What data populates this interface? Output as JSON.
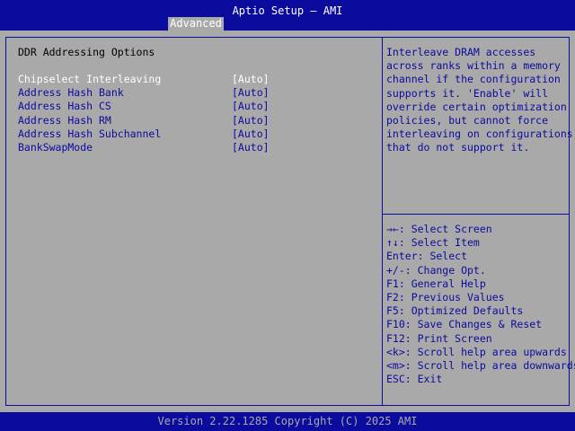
{
  "header": {
    "title": "Aptio Setup – AMI",
    "tabs": [
      {
        "label": "Advanced"
      }
    ]
  },
  "page": {
    "section_title": "DDR Addressing Options"
  },
  "settings": [
    {
      "label": "Chipselect Interleaving",
      "value": "[Auto]"
    },
    {
      "label": "Address Hash Bank",
      "value": "[Auto]"
    },
    {
      "label": "Address Hash CS",
      "value": "[Auto]"
    },
    {
      "label": "Address Hash RM",
      "value": "[Auto]"
    },
    {
      "label": "Address Hash Subchannel",
      "value": "[Auto]"
    },
    {
      "label": "BankSwapMode",
      "value": "[Auto]"
    }
  ],
  "help": {
    "text": "Interleave DRAM accesses\nacross ranks within a memory\nchannel if the configuration\nsupports it. 'Enable' will\noverride certain optimization\npolicies, but cannot force\ninterleaving on configurations\nthat do not support it."
  },
  "key_help": [
    "→←: Select Screen",
    "↑↓: Select Item",
    "Enter: Select",
    "+/-: Change Opt.",
    "F1: General Help",
    "F2: Previous Values",
    "F5: Optimized Defaults",
    "F10: Save Changes & Reset",
    "F12: Print Screen",
    "<k>: Scroll help area upwards",
    "<m>: Scroll help area downwards",
    "ESC: Exit"
  ],
  "footer": {
    "version": "Version 2.22.1285 Copyright (C) 2025 AMI"
  },
  "colors": {
    "primary": "#0b0b9e",
    "background": "#a9a9a9",
    "highlight": "#ffffff"
  }
}
